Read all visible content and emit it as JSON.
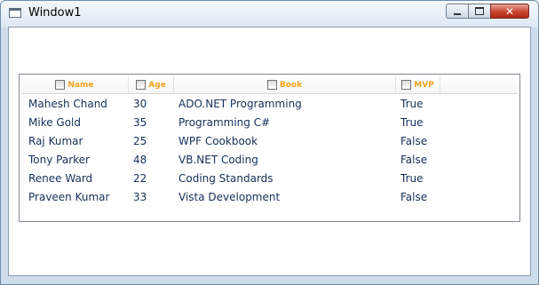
{
  "window": {
    "title": "Window1",
    "controls": {
      "minimize_icon": "minimize-icon",
      "maximize_icon": "maximize-icon",
      "close_icon": "close-icon",
      "close_glyph": "✕"
    }
  },
  "listview": {
    "columns": [
      {
        "label": "Name"
      },
      {
        "label": "Age"
      },
      {
        "label": "Book"
      },
      {
        "label": "MVP"
      }
    ],
    "rows": [
      {
        "name": "Mahesh Chand",
        "age": "30",
        "book": "ADO.NET Programming",
        "mvp": "True"
      },
      {
        "name": "Mike Gold",
        "age": "35",
        "book": "Programming C#",
        "mvp": "True"
      },
      {
        "name": "Raj Kumar",
        "age": "25",
        "book": "WPF Cookbook",
        "mvp": "False"
      },
      {
        "name": "Tony Parker",
        "age": "48",
        "book": "VB.NET Coding",
        "mvp": "False"
      },
      {
        "name": "Renee Ward",
        "age": "22",
        "book": "Coding Standards",
        "mvp": "True"
      },
      {
        "name": "Praveen Kumar",
        "age": "33",
        "book": "Vista Development",
        "mvp": "False"
      }
    ]
  },
  "colors": {
    "header_text": "#f0a21c",
    "cell_text": "#14305a"
  }
}
